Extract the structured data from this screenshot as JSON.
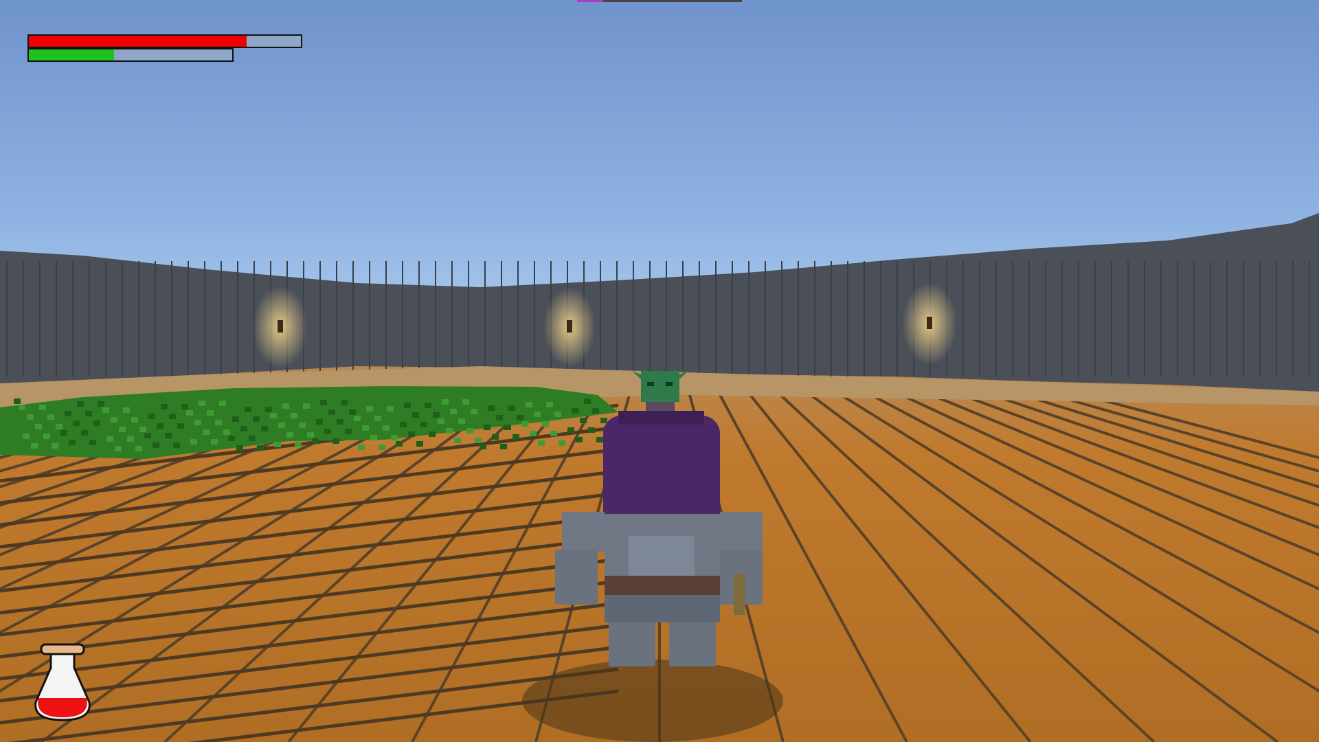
{
  "hud": {
    "health": {
      "fraction": 0.8,
      "fill_color": "#ee0000"
    },
    "stamina": {
      "fraction": 0.42,
      "fill_color": "#1ec21e"
    },
    "boss": {
      "fraction": 0.16,
      "fill_color": "#b03cc8"
    },
    "potion": {
      "icon": "health-potion-icon",
      "liquid_color": "#ee1111"
    }
  },
  "world": {
    "sky_color_top": "#6e93cd",
    "sky_color_horizon": "#9bc0e8",
    "wall_color": "#4a4f58",
    "floor_color": "#c07a2e",
    "grass_color": "#2e7d25",
    "torch_count": 3,
    "player": {
      "description_icon": "player-knight-icon",
      "hair_color": "#4a2868",
      "armor_color": "#6f7784"
    },
    "enemy": {
      "description_icon": "goblin-icon",
      "skin_color": "#2e7a4a"
    }
  }
}
